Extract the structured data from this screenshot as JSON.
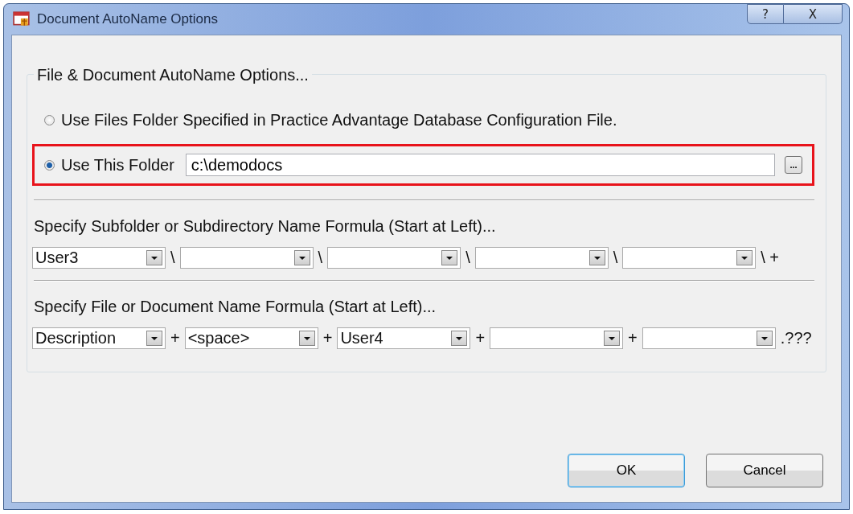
{
  "window": {
    "title": "Document AutoName Options",
    "buttons": [
      "?",
      "X"
    ]
  },
  "group": {
    "legend": "File & Document AutoName Options...",
    "options": [
      {
        "label": "Use Files Folder Specified in Practice Advantage Database Configuration File.",
        "selected": false
      },
      {
        "label": "Use This Folder",
        "selected": true,
        "field": "c:\\demodocs",
        "browse": "...",
        "highlighted": true
      }
    ],
    "subfolder": {
      "label": "Specify Subfolder or Subdirectory Name Formula (Start at Left)...",
      "combos": [
        {
          "value": "User3",
          "separator": "\\"
        },
        {
          "separator": "\\"
        },
        {
          "separator": "\\"
        },
        {
          "separator": "\\"
        },
        {
          "separator": "\\ +"
        }
      ]
    },
    "filename": {
      "label": "Specify File or Document Name Formula (Start at Left)...",
      "combos": [
        {
          "value": "Description",
          "separator": "+"
        },
        {
          "value": "<space>",
          "separator": "+"
        },
        {
          "value": "User4",
          "separator": "+"
        },
        {
          "separator": "+"
        },
        {
          "separator": ".???"
        }
      ]
    }
  },
  "buttons": [
    {
      "label": "OK",
      "default": true
    },
    {
      "label": "Cancel",
      "default": false
    }
  ]
}
